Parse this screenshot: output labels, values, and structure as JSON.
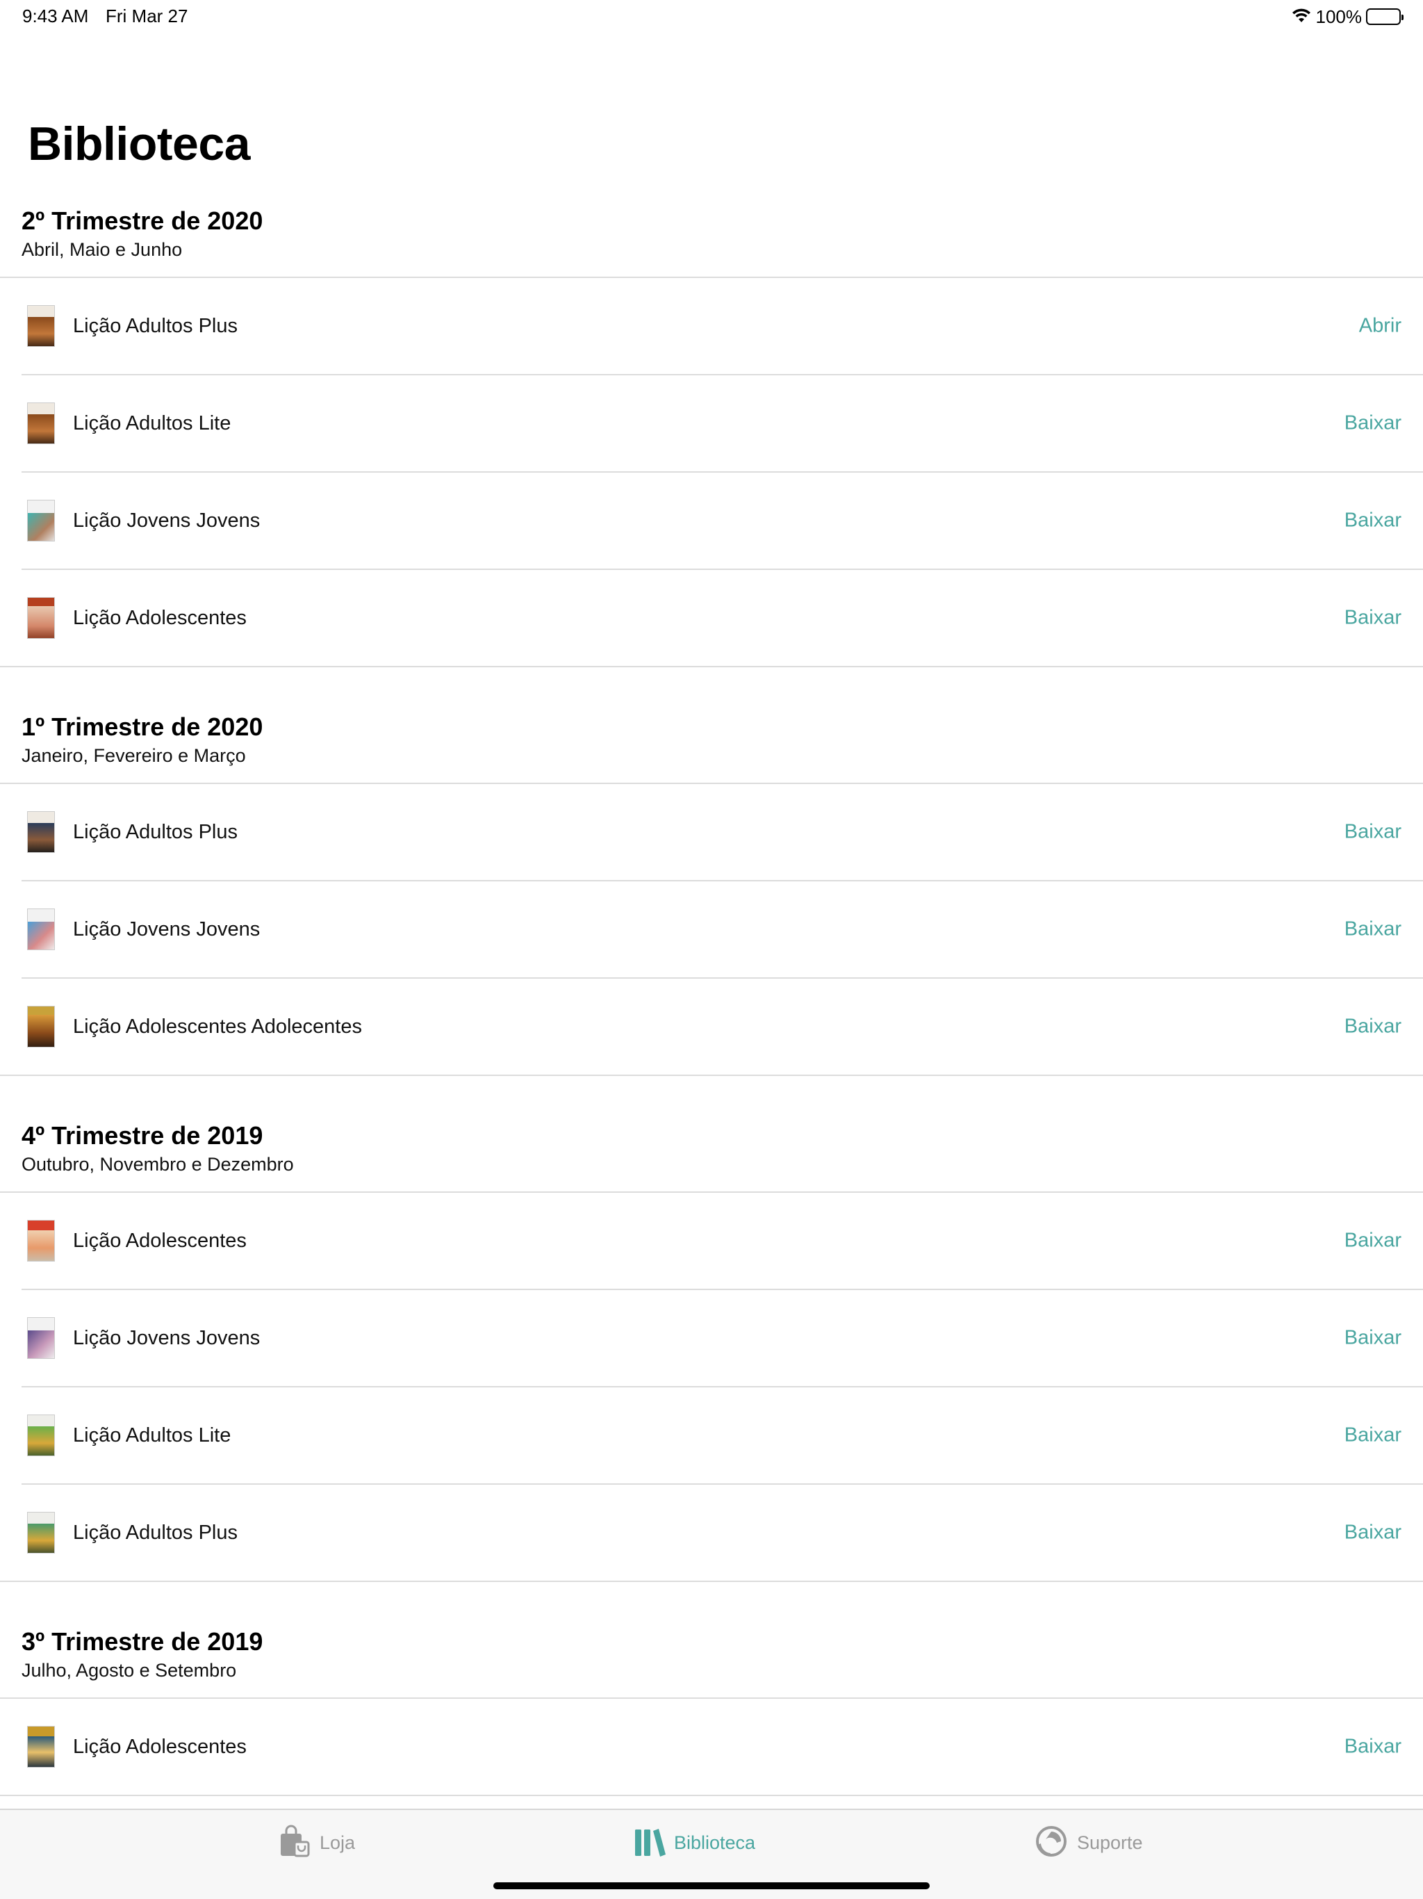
{
  "status_bar": {
    "time": "9:43 AM",
    "date": "Fri Mar 27",
    "battery": "100%",
    "wifi_icon": "wifi-icon",
    "battery_icon": "battery-icon"
  },
  "title": "Biblioteca",
  "sections": [
    {
      "title": "2º Trimestre de 2020",
      "subtitle": "Abril, Maio e Junho",
      "items": [
        {
          "label": "Lição Adultos Plus",
          "action": "Abrir"
        },
        {
          "label": "Lição Adultos Lite",
          "action": "Baixar"
        },
        {
          "label": "Lição Jovens Jovens",
          "action": "Baixar"
        },
        {
          "label": "Lição Adolescentes",
          "action": "Baixar"
        }
      ]
    },
    {
      "title": "1º Trimestre de 2020",
      "subtitle": "Janeiro, Fevereiro e Março",
      "items": [
        {
          "label": "Lição Adultos Plus",
          "action": "Baixar"
        },
        {
          "label": "Lição Jovens Jovens",
          "action": "Baixar"
        },
        {
          "label": "Lição Adolescentes Adolecentes",
          "action": "Baixar"
        }
      ]
    },
    {
      "title": "4º Trimestre de 2019",
      "subtitle": "Outubro, Novembro e Dezembro",
      "items": [
        {
          "label": "Lição Adolescentes",
          "action": "Baixar"
        },
        {
          "label": "Lição Jovens Jovens",
          "action": "Baixar"
        },
        {
          "label": "Lição Adultos Lite",
          "action": "Baixar"
        },
        {
          "label": "Lição Adultos Plus",
          "action": "Baixar"
        }
      ]
    },
    {
      "title": "3º Trimestre de 2019",
      "subtitle": "Julho, Agosto e Setembro",
      "items": [
        {
          "label": "Lição Adolescentes",
          "action": "Baixar"
        }
      ]
    }
  ],
  "tab_bar": {
    "tabs": [
      {
        "label": "Loja",
        "icon": "shopping-bag-icon",
        "active": false
      },
      {
        "label": "Biblioteca",
        "icon": "library-books-icon",
        "active": true
      },
      {
        "label": "Suporte",
        "icon": "support-headset-icon",
        "active": false
      }
    ]
  },
  "colors": {
    "accent": "#4aa6a0",
    "separator": "#dcdcdc",
    "tab_inactive": "#9a9a9a",
    "tab_bar_bg": "#f7f7f7"
  }
}
